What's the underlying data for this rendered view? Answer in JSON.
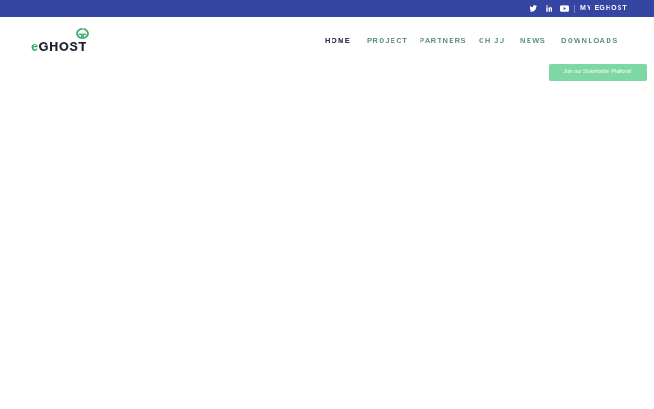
{
  "topbar": {
    "background": "#3446a2",
    "social_icons": [
      "twitter-icon",
      "linkedin-icon",
      "youtube-icon"
    ],
    "my_link_label": "MY EGHOST"
  },
  "logo": {
    "prefix": "e",
    "main": "GHOST",
    "mark_color": "#3dae72"
  },
  "nav": {
    "items": [
      {
        "label": "HOME",
        "active": true
      },
      {
        "label": "PROJECT",
        "active": false
      },
      {
        "label": "PARTNERS",
        "active": false
      },
      {
        "label": "CH JU",
        "active": false
      },
      {
        "label": "NEWS",
        "active": false
      },
      {
        "label": "DOWNLOADS",
        "active": false
      }
    ],
    "active_color": "#1c2340",
    "inactive_color": "#5d8c86"
  },
  "cta": {
    "label": "Join our Stakeholder Platform!",
    "background": "#7ed8a4"
  }
}
